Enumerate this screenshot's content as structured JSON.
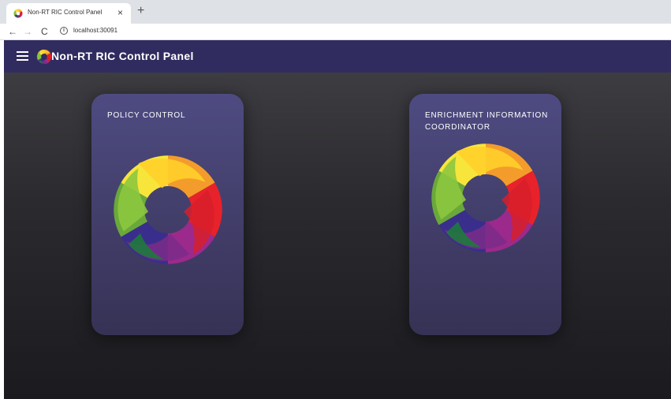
{
  "browser": {
    "tab_title": "Non-RT RIC Control Panel",
    "tab_close": "×",
    "new_tab": "+",
    "url": "localhost:30091",
    "nav_back": "←",
    "nav_forward": "→",
    "nav_reload": "C",
    "info": "i"
  },
  "app": {
    "title": "Non-RT RIC Control Panel",
    "menu_icon": "hamburger-menu-icon",
    "logo_icon": "o-ran-logo-icon"
  },
  "cards": [
    {
      "title": "POLICY CONTROL",
      "icon": "o-ran-logo-icon"
    },
    {
      "title": "ENRICHMENT INFORMATION COORDINATOR",
      "icon": "o-ran-logo-icon"
    }
  ],
  "colors": {
    "toolbar": "#312c5f",
    "card": "#4e4b82",
    "logo_segments": [
      "#ffe837",
      "#f5a028",
      "#e8332a",
      "#ec1c24",
      "#92278f",
      "#5b2c8f",
      "#2e3192",
      "#1a8a3a",
      "#8dc63f",
      "#d4e157"
    ]
  }
}
